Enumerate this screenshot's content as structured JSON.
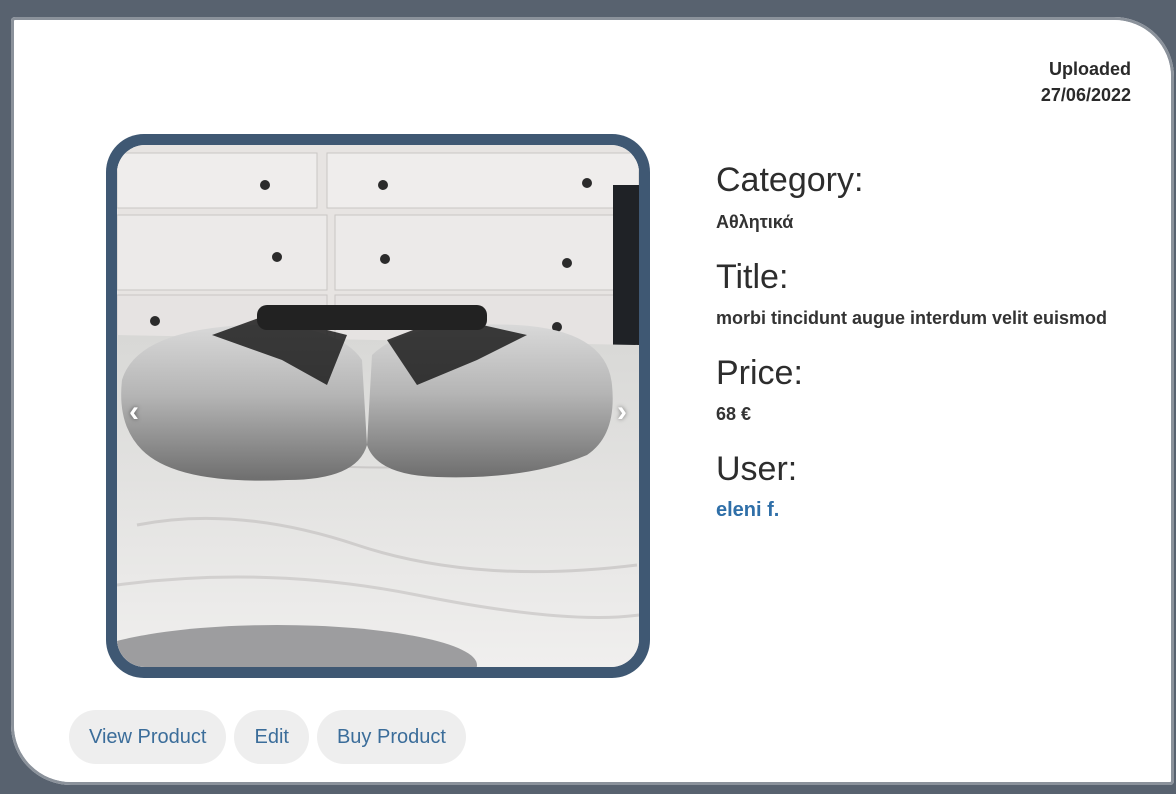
{
  "uploaded": {
    "label": "Uploaded",
    "date": "27/06/2022"
  },
  "carousel": {
    "prev_glyph": "‹",
    "next_glyph": "›",
    "prev_icon": "chevron-left-icon",
    "next_icon": "chevron-right-icon"
  },
  "details": {
    "category_label": "Category:",
    "category_value": "Αθλητικά",
    "title_label": "Title:",
    "title_value": "morbi tincidunt augue interdum velit euismod",
    "price_label": "Price:",
    "price_value": "68 €",
    "user_label": "User:",
    "user_value": "eleni f."
  },
  "buttons": {
    "view": "View Product",
    "edit": "Edit",
    "buy": "Buy Product"
  },
  "colors": {
    "frame": "#58626f",
    "carousel_border": "#3f5873",
    "link": "#2f6fa8",
    "button_bg": "#eeeeee"
  }
}
